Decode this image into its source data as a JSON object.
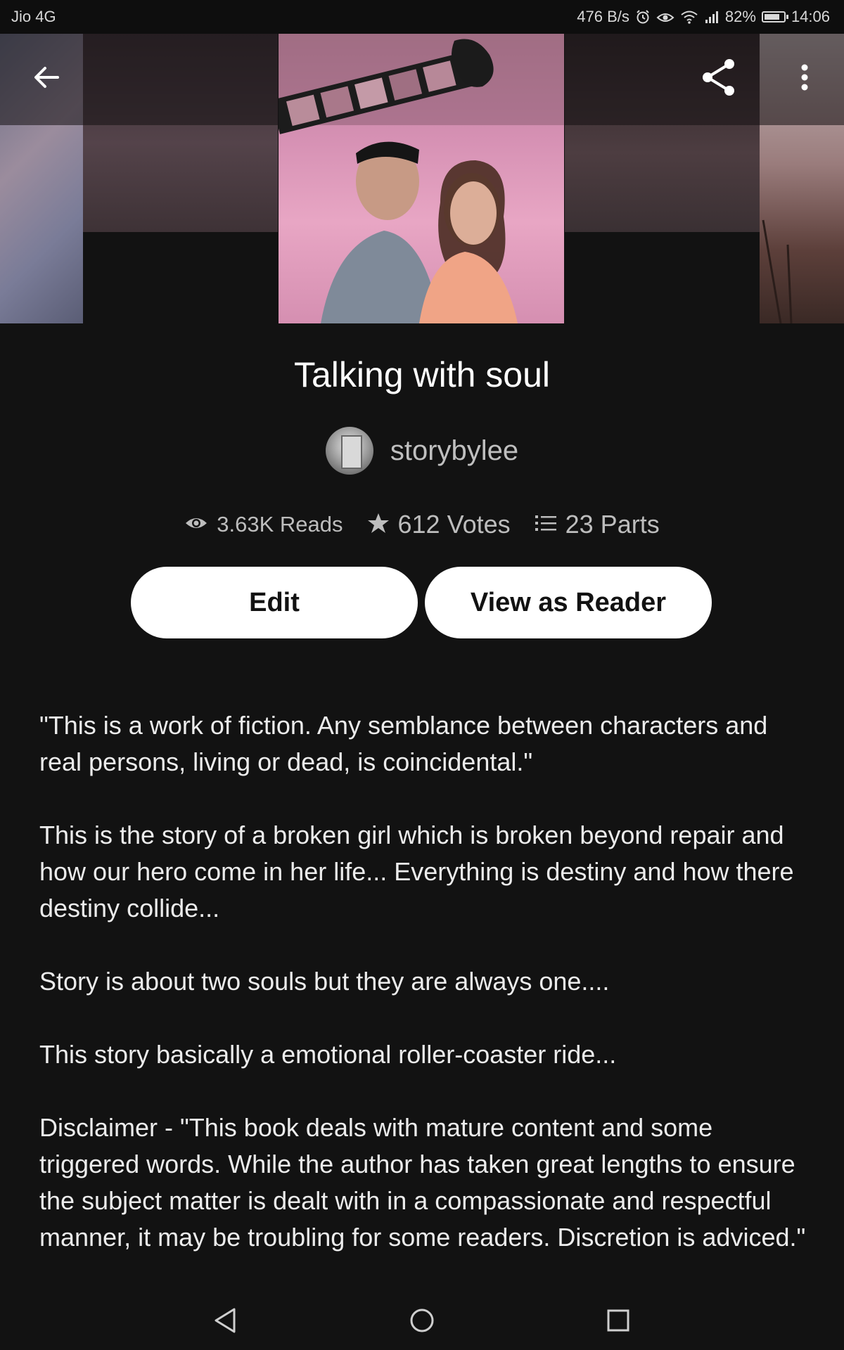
{
  "status_bar": {
    "carrier": "Jio 4G",
    "net_speed": "476 B/s",
    "battery_percent": "82%",
    "battery_level": 0.82,
    "time": "14:06",
    "icons": [
      "alarm-icon",
      "eye-icon",
      "wifi-icon",
      "signal-icon",
      "battery-icon"
    ]
  },
  "toolbar": {
    "back_icon": "arrow-left-icon",
    "share_icon": "share-icon",
    "more_icon": "more-vertical-icon"
  },
  "story": {
    "title": "Talking with soul",
    "author": "storybylee",
    "reads": "3.63K Reads",
    "votes": "612 Votes",
    "parts": "23 Parts"
  },
  "actions": {
    "edit_label": "Edit",
    "view_reader_label": "View as Reader"
  },
  "description": [
    "\"This is a work of fiction. Any semblance between characters and real persons, living or dead, is coincidental.\"",
    "This is the story of a broken girl which is broken beyond repair and how our hero come in her life... Everything is destiny and how there destiny collide...",
    "Story is about two souls but they are always one....",
    "This story basically a emotional roller-coaster ride...",
    "Disclaimer - \"This book deals with mature content and some triggered words. While the author has taken great lengths to ensure the subject matter is dealt with in a compassionate and respectful manner, it may be troubling for some readers. Discretion is adviced.\""
  ],
  "nav_bar": {
    "icons": [
      "nav-back-icon",
      "nav-home-icon",
      "nav-recents-icon"
    ]
  },
  "colors": {
    "background": "#121212",
    "button_bg": "#ffffff",
    "button_text": "#121212",
    "secondary_text": "#bdbdbd"
  }
}
